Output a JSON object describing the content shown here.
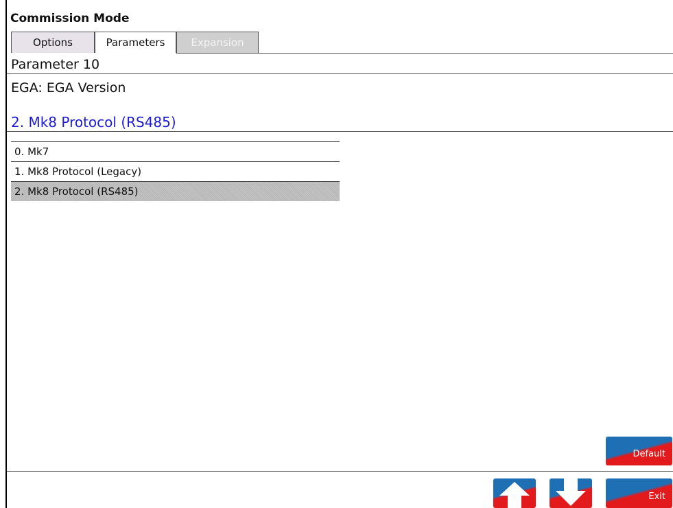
{
  "header": {
    "title": "Commission Mode"
  },
  "tabs": [
    {
      "label": "Options",
      "state": "normal"
    },
    {
      "label": "Parameters",
      "state": "active"
    },
    {
      "label": "Expansion",
      "state": "disabled"
    }
  ],
  "parameter": {
    "number_label": "Parameter 10",
    "name": "EGA: EGA Version",
    "current_value": "2. Mk8 Protocol (RS485)"
  },
  "options": [
    {
      "label": "0. Mk7",
      "selected": false
    },
    {
      "label": "1. Mk8 Protocol (Legacy)",
      "selected": false
    },
    {
      "label": "2. Mk8 Protocol (RS485)",
      "selected": true
    }
  ],
  "buttons": {
    "default_label": "Default",
    "exit_label": "Exit",
    "up_icon": "arrow-up-icon",
    "down_icon": "arrow-down-icon"
  },
  "colors": {
    "button_blue": "#1f6fb4",
    "button_red": "#e31a1c",
    "selected_value_text": "#1d1ad6",
    "selected_row": "#bebebe"
  }
}
